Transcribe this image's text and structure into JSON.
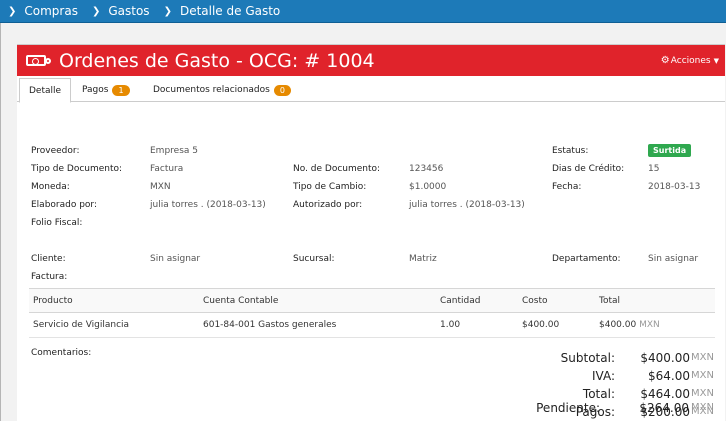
{
  "breadcrumb": [
    "Compras",
    "Gastos",
    "Detalle de Gasto"
  ],
  "header": {
    "title": "Ordenes de Gasto - OCG: # 1004",
    "actions_label": "Acciones"
  },
  "tabs": [
    {
      "label": "Detalle",
      "active": true
    },
    {
      "label": "Pagos",
      "badge": "1"
    },
    {
      "label": "Documentos relacionados",
      "badge": "0"
    }
  ],
  "fields": {
    "proveedor": {
      "label": "Proveedor:",
      "value": "Empresa 5"
    },
    "tipo_documento": {
      "label": "Tipo de Documento:",
      "value": "Factura"
    },
    "moneda": {
      "label": "Moneda:",
      "value": "MXN"
    },
    "elaborado_por": {
      "label": "Elaborado por:",
      "value": "julia torres . (2018-03-13)"
    },
    "folio_fiscal": {
      "label": "Folio Fiscal:",
      "value": ""
    },
    "no_documento": {
      "label": "No. de Documento:",
      "value": "123456"
    },
    "tipo_cambio": {
      "label": "Tipo de Cambio:",
      "value": "$1.0000"
    },
    "autorizado_por": {
      "label": "Autorizado por:",
      "value": "julia torres . (2018-03-13)"
    },
    "estatus": {
      "label": "Estatus:",
      "value": "Surtida"
    },
    "dias_credito": {
      "label": "Dias de Crédito:",
      "value": "15"
    },
    "fecha": {
      "label": "Fecha:",
      "value": "2018-03-13"
    },
    "cliente": {
      "label": "Cliente:",
      "value": "Sin asignar"
    },
    "factura": {
      "label": "Factura:",
      "value": ""
    },
    "sucursal": {
      "label": "Sucursal:",
      "value": "Matriz"
    },
    "departamento": {
      "label": "Departamento:",
      "value": "Sin asignar"
    }
  },
  "table": {
    "headers": [
      "Producto",
      "Cuenta Contable",
      "Cantidad",
      "Costo",
      "Total"
    ],
    "rows": [
      {
        "producto": "Servicio de Vigilancia",
        "cuenta": "601-84-001 Gastos generales",
        "cantidad": "1.00",
        "costo": "$400.00",
        "total": "$400.00",
        "currency": "MXN"
      }
    ]
  },
  "comments_label": "Comentarios:",
  "totals": [
    {
      "label": "Subtotal:",
      "value": "$400.00",
      "currency": "MXN"
    },
    {
      "label": "IVA:",
      "value": "$64.00",
      "currency": "MXN"
    },
    {
      "label": "Total:",
      "value": "$464.00",
      "currency": "MXN"
    },
    {
      "label": "Pagos:",
      "value": "$200.00",
      "currency": "MXN"
    },
    {
      "label": "Pendiente:",
      "value": "$264.00",
      "currency": "MXN"
    }
  ],
  "colors": {
    "breadcrumb_bg": "#1d7ab8",
    "header_bg": "#e0232b",
    "status_badge": "#2fa84f",
    "count_badge": "#e68a00"
  }
}
